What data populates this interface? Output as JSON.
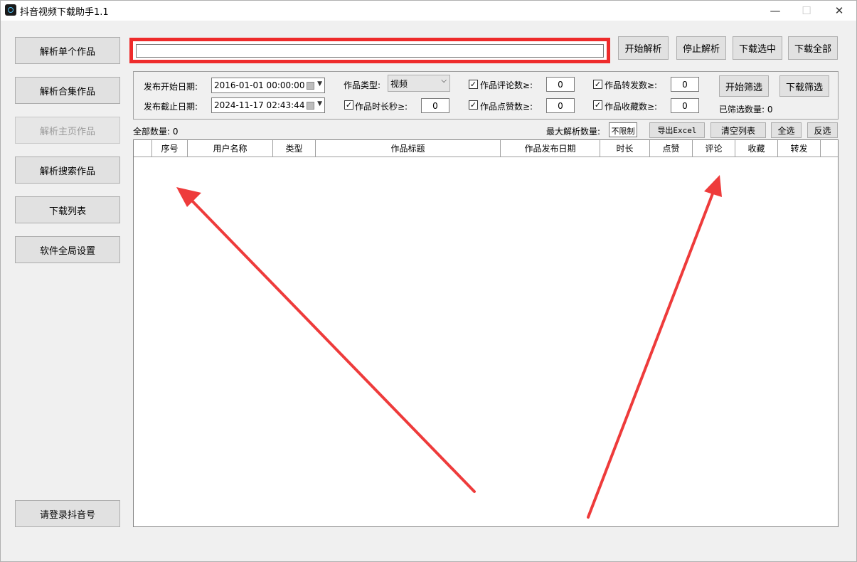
{
  "window": {
    "title": "抖音视频下载助手1.1",
    "controls": {
      "minimize": "—",
      "maximize": "☐",
      "close": "✕"
    }
  },
  "sidebar": {
    "items": [
      {
        "label": "解析单个作品",
        "enabled": true
      },
      {
        "label": "解析合集作品",
        "enabled": true
      },
      {
        "label": "解析主页作品",
        "enabled": false
      },
      {
        "label": "解析搜索作品",
        "enabled": true
      },
      {
        "label": "下载列表",
        "enabled": true
      },
      {
        "label": "软件全局设置",
        "enabled": true
      }
    ],
    "login_label": "请登录抖音号"
  },
  "toolbar": {
    "url_value": "",
    "start_parse": "开始解析",
    "stop_parse": "停止解析",
    "download_selected": "下载选中",
    "download_all": "下载全部"
  },
  "filters": {
    "start_date_label": "发布开始日期:",
    "start_date_value": "2016-01-01 00:00:00",
    "end_date_label": "发布截止日期:",
    "end_date_value": "2024-11-17 02:43:44",
    "type_label": "作品类型:",
    "type_value": "视频",
    "duration_label": "作品时长秒≥:",
    "duration_value": "0",
    "comments_label": "作品评论数≥:",
    "comments_value": "0",
    "likes_label": "作品点赞数≥:",
    "likes_value": "0",
    "shares_label": "作品转发数≥:",
    "shares_value": "0",
    "favorites_label": "作品收藏数≥:",
    "favorites_value": "0",
    "start_filter": "开始筛选",
    "download_filtered": "下载筛选",
    "filtered_count_label": "已筛选数量: 0",
    "check_mark": "✓"
  },
  "list_bar": {
    "total_label": "全部数量: 0",
    "max_parse_label": "最大解析数量:",
    "max_parse_value": "不限制",
    "export_excel": "导出Excel",
    "clear_list": "清空列表",
    "select_all": "全选",
    "invert_selection": "反选"
  },
  "table": {
    "columns": [
      "",
      "序号",
      "用户名称",
      "类型",
      "作品标题",
      "作品发布日期",
      "时长",
      "点赞",
      "评论",
      "收藏",
      "转发",
      ""
    ],
    "rows": []
  },
  "colors": {
    "highlight_red": "#ee2b2b",
    "arrow_red": "#ee3b3b",
    "window_bg": "#f0f0f0",
    "button_bg": "#e1e1e1"
  }
}
